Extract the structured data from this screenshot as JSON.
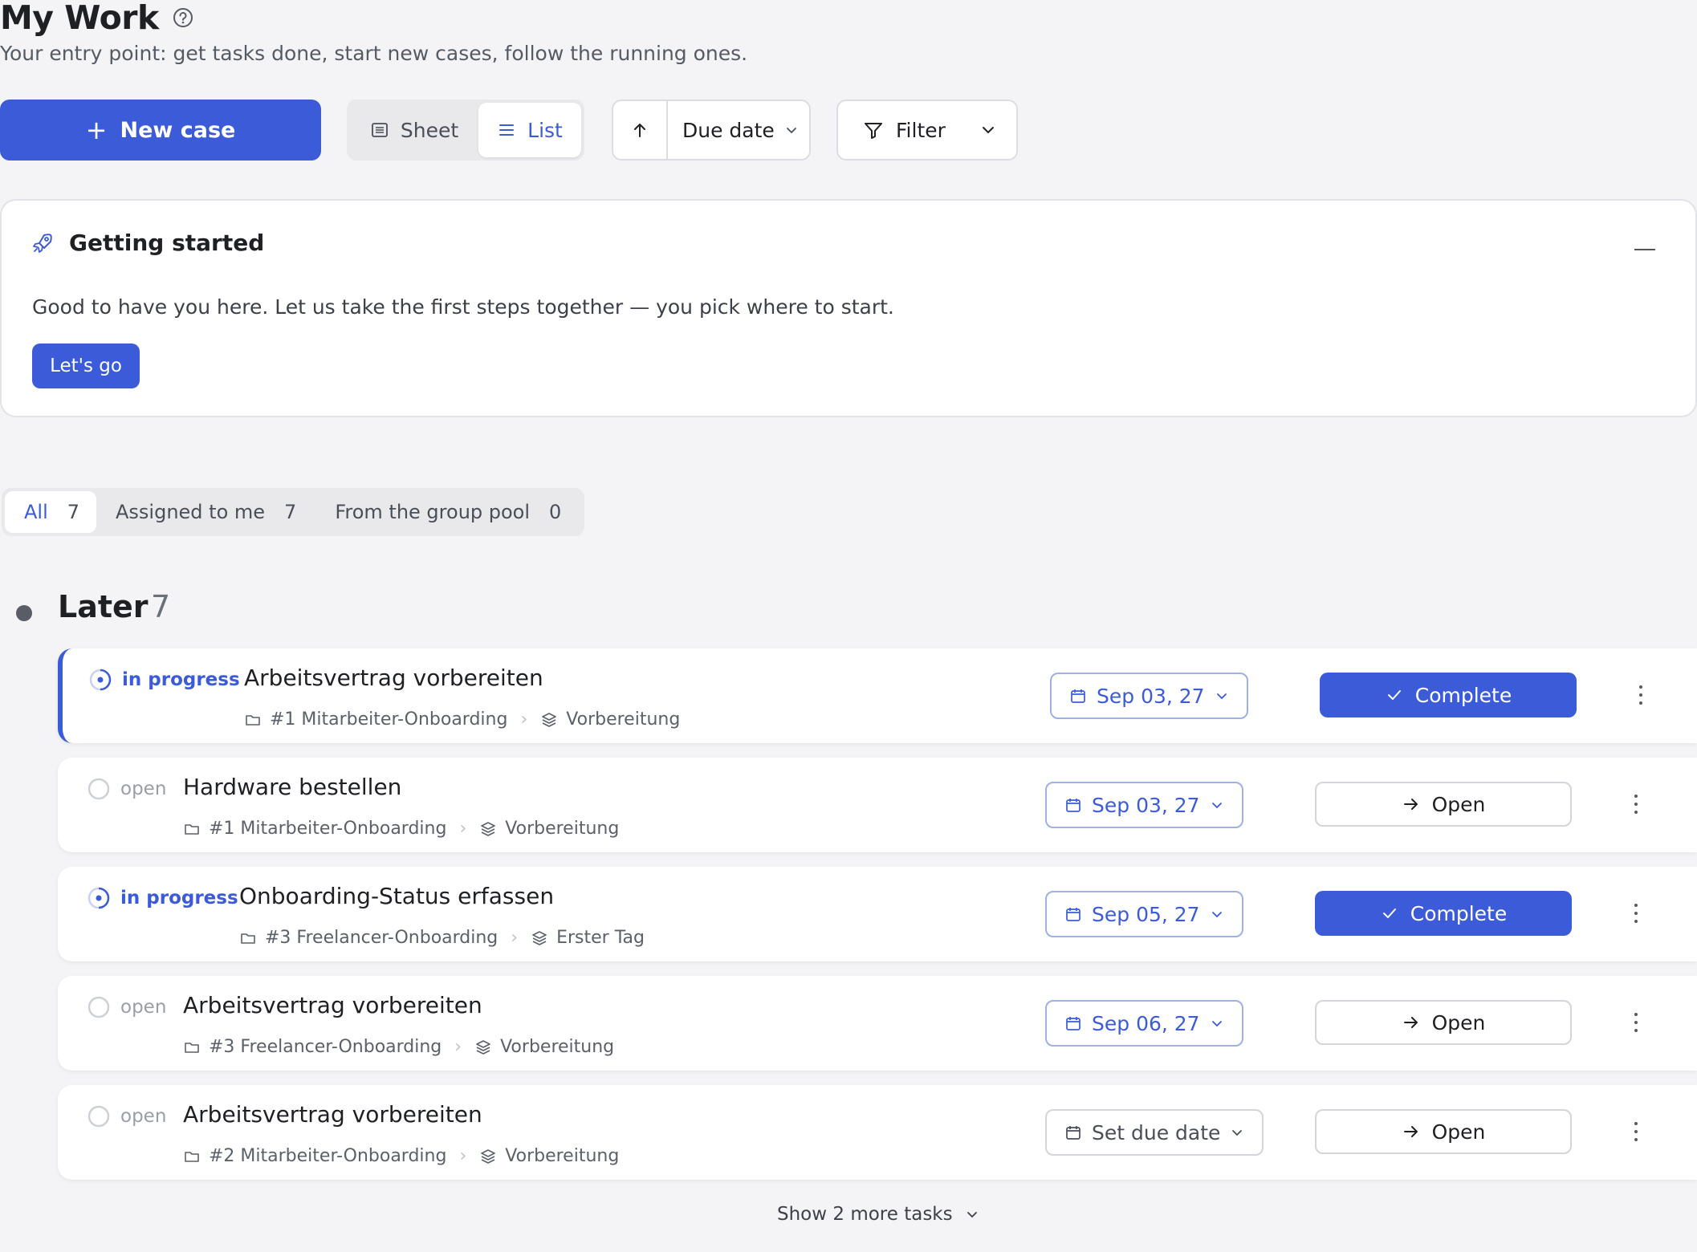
{
  "header": {
    "title": "My Work",
    "subtitle": "Your entry point: get tasks done, start new cases, follow the running ones."
  },
  "toolbar": {
    "new_case_label": "New case",
    "view_sheet_label": "Sheet",
    "view_list_label": "List",
    "sort_label": "Due date",
    "filter_label": "Filter"
  },
  "getting_started": {
    "title": "Getting started",
    "text": "Good to have you here. Let us take the first steps together — you pick where to start.",
    "button_label": "Let's go"
  },
  "tabs": [
    {
      "label": "All",
      "count": "7"
    },
    {
      "label": "Assigned to me",
      "count": "7"
    },
    {
      "label": "From the group pool",
      "count": "0"
    }
  ],
  "group": {
    "title": "Later",
    "count": "7"
  },
  "tasks": [
    {
      "status": "in progress",
      "title": "Arbeitsvertrag vorbereiten",
      "case": "#1 Mitarbeiter-Onboarding",
      "stage": "Vorbereitung",
      "due": "Sep 03, 27",
      "action": "Complete"
    },
    {
      "status": "open",
      "title": "Hardware bestellen",
      "case": "#1 Mitarbeiter-Onboarding",
      "stage": "Vorbereitung",
      "due": "Sep 03, 27",
      "action": "Open"
    },
    {
      "status": "in progress",
      "title": "Onboarding-Status erfassen",
      "case": "#3 Freelancer-Onboarding",
      "stage": "Erster Tag",
      "due": "Sep 05, 27",
      "action": "Complete"
    },
    {
      "status": "open",
      "title": "Arbeitsvertrag vorbereiten",
      "case": "#3 Freelancer-Onboarding",
      "stage": "Vorbereitung",
      "due": "Sep 06, 27",
      "action": "Open"
    },
    {
      "status": "open",
      "title": "Arbeitsvertrag vorbereiten",
      "case": "#2 Mitarbeiter-Onboarding",
      "stage": "Vorbereitung",
      "due": "Set due date",
      "action": "Open"
    }
  ],
  "show_more_label": "Show 2 more tasks",
  "colors": {
    "accent": "#3c5bd9",
    "background": "#f4f4f6"
  }
}
